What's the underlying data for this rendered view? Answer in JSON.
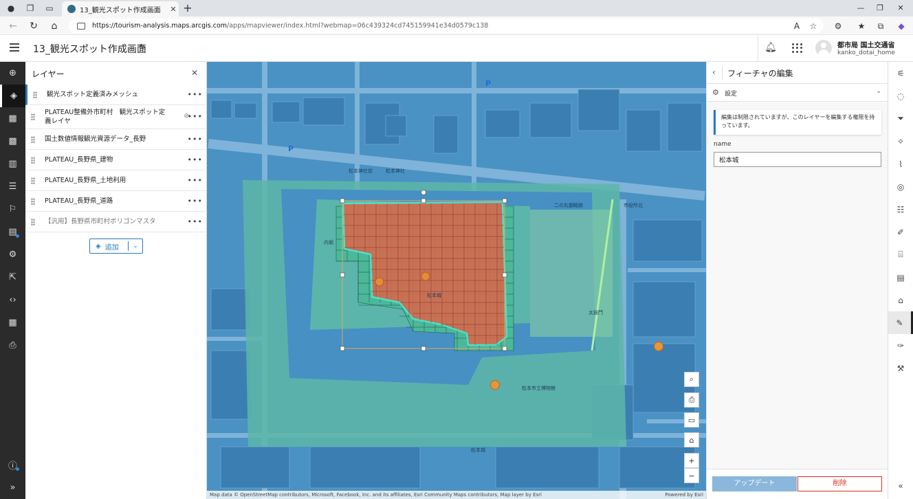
{
  "browser": {
    "tab_title": "13_観光スポット作成画面",
    "url_host": "https://tourism-analysis.maps.arcgis.com",
    "url_path": "/apps/mapviewer/index.html?webmap=06c439324cd745159941e34d0579c138"
  },
  "app": {
    "title": "13_観光スポット作成画面",
    "user_name": "都市局 国土交通省",
    "user_id": "kanko_dotai_home"
  },
  "layers_panel": {
    "title": "レイヤー",
    "items": [
      {
        "name": "観光スポット定義済みメッシュ"
      },
      {
        "name": "PLATEAU整備外市町村　観光スポット定義レイヤ"
      },
      {
        "name": "国土数値情報観光資源データ_長野"
      },
      {
        "name": "PLATEAU_長野県_建物"
      },
      {
        "name": "PLATEAU_長野県_土地利用"
      },
      {
        "name": "PLATEAU_長野県_道路"
      },
      {
        "name": "【汎用】長野県市町村ポリゴンマスタ"
      }
    ],
    "add_label": "追加"
  },
  "map": {
    "labels": {
      "shrine": "松本神社前",
      "matsumoto_jinja": "松本神社",
      "inner_moat": "二の丸御殿跡",
      "city_hall": "市役所北",
      "castle": "松本城",
      "pond_label": "内堀",
      "castle_gate": "太鼓門",
      "bottom_castle": "松本城",
      "museum": "松本市立博物館"
    },
    "attribution": "Map data © OpenStreetMap contributors, Microsoft, Facebook, Inc. and its affiliates, Esri Community Maps contributors, Map layer by Esri",
    "powered_by": "Powered by Esri"
  },
  "edit_panel": {
    "title": "フィーチャの編集",
    "settings_label": "設定",
    "notice": "編集は制限されていますが、このレイヤーを編集する権限を持っています。",
    "field_label": "name",
    "field_value": "松本城",
    "update_label": "アップデート",
    "delete_label": "削除"
  }
}
